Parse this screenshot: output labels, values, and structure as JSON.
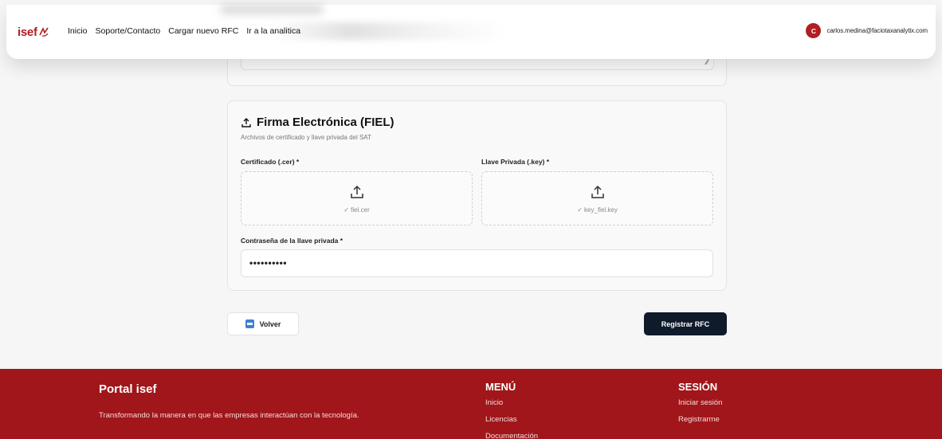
{
  "header": {
    "logo": "isef",
    "nav": [
      "Inicio",
      "Soporte/Contacto",
      "Cargar nuevo RFC",
      "Ir a la analitica"
    ],
    "user": {
      "initial": "C",
      "email": "carlos.medina@faciotaxanalytix.com"
    }
  },
  "fiel": {
    "title": "Firma Electrónica (FIEL)",
    "subtitle": "Archivos de certificado y llave privada del SAT",
    "cert_label": "Certificado (.cer) *",
    "cert_file": "✓ fiel.cer",
    "key_label": "Llave Privada (.key) *",
    "key_file": "✓ key_fiel.key",
    "password_label": "Contraseña de la llave privada *",
    "password_value": "••••••••••"
  },
  "actions": {
    "back": "Volver",
    "submit": "Registrar RFC"
  },
  "footer": {
    "title": "Portal isef",
    "description": "Transformando la manera en que las empresas interactúan con la tecnología.",
    "menu_title": "MENÚ",
    "menu_items": [
      "Inicio",
      "Licencias",
      "Documentación"
    ],
    "session_title": "SESIÓN",
    "session_items": [
      "Iniciar sesión",
      "Registrarme"
    ]
  },
  "colors": {
    "brand": "#a0161a",
    "primary_button": "#0f1a2b",
    "back_icon": "#3f7fd3"
  }
}
